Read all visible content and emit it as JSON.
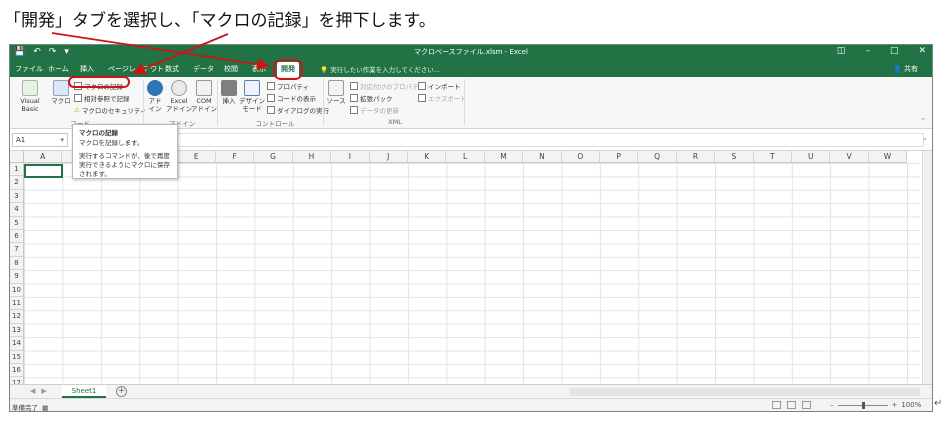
{
  "caption": "「開発」タブを選択し、「マクロの記録」を押下します。",
  "window": {
    "title": "マクロベースファイル.xlsm - Excel",
    "share": "共有",
    "tell_me": "実行したい作業を入力してください..."
  },
  "tabs": [
    "ファイル",
    "ホーム",
    "挿入",
    "ページレイアウト",
    "数式",
    "データ",
    "校閲",
    "表示",
    "開発"
  ],
  "active_tab": "開発",
  "ribbon": {
    "code": {
      "visual_basic": "Visual Basic",
      "macro": "マクロ",
      "record_macro": "マクロの記録",
      "relative_ref": "相対参照で記録",
      "macro_security": "マクロのセキュリティ",
      "label": "コード"
    },
    "addin": {
      "addin": "アド\nイン",
      "excel_addin": "Excel\nアドイン",
      "com_addin": "COM\nアドイン",
      "label": "アドイン"
    },
    "controls": {
      "insert": "挿入",
      "design_mode": "デザイン\nモード",
      "properties": "プロパティ",
      "view_code": "コードの表示",
      "run_dialog": "ダイアログの実行",
      "label": "コントロール"
    },
    "xml": {
      "source": "ソース",
      "map_properties": "対応付けのプロパティ",
      "expansion_pack": "拡張パック",
      "refresh_data": "データの更新",
      "import": "インポート",
      "export": "エクスポート",
      "label": "XML"
    }
  },
  "tooltip": {
    "title": "マクロの記録",
    "line1": "マクロを記録します。",
    "body": "実行するコマンドが、後で再度実行できるようにマクロに保存されます。"
  },
  "formula_bar": {
    "name_box": "A1"
  },
  "columns": [
    "A",
    "B",
    "C",
    "D",
    "E",
    "F",
    "G",
    "H",
    "I",
    "J",
    "K",
    "L",
    "M",
    "N",
    "O",
    "P",
    "Q",
    "R",
    "S",
    "T",
    "U",
    "V",
    "W"
  ],
  "rows": [
    "1",
    "2",
    "3",
    "4",
    "5",
    "6",
    "7",
    "8",
    "9",
    "10",
    "11",
    "12",
    "13",
    "14",
    "15",
    "16",
    "17"
  ],
  "sheet_tab": "Sheet1",
  "status": {
    "ready": "準備完了",
    "zoom": "100%"
  },
  "colors": {
    "excel_green": "#217346",
    "highlight_red": "#cc1414"
  }
}
